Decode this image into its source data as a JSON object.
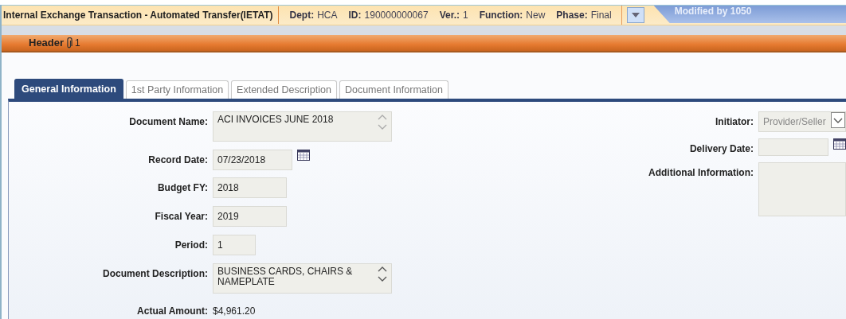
{
  "title_bar": {
    "title": "Internal Exchange Transaction - Automated Transfer(IETAT)",
    "fields": [
      {
        "label": "Dept:",
        "value": "HCA"
      },
      {
        "label": "ID:",
        "value": "190000000067"
      },
      {
        "label": "Ver.:",
        "value": "1"
      },
      {
        "label": "Function:",
        "value": "New"
      },
      {
        "label": "Phase:",
        "value": "Final"
      }
    ],
    "modified": "Modified by 1050"
  },
  "section": {
    "title": "Header",
    "attachment_count": "1"
  },
  "tabs": [
    {
      "label": "General Information",
      "selected": true
    },
    {
      "label": "1st Party Information",
      "selected": false
    },
    {
      "label": "Extended Description",
      "selected": false
    },
    {
      "label": "Document Information",
      "selected": false
    }
  ],
  "left_fields": [
    {
      "label": "Document Name:",
      "value": "ACI INVOICES JUNE 2018",
      "kind": "textarea"
    },
    {
      "label": "Record Date:",
      "value": "07/23/2018",
      "kind": "date"
    },
    {
      "label": "Budget FY:",
      "value": "2018",
      "kind": "text"
    },
    {
      "label": "Fiscal Year:",
      "value": "2019",
      "kind": "text"
    },
    {
      "label": "Period:",
      "value": "1",
      "kind": "short"
    },
    {
      "label": "Document Description:",
      "value": "BUSINESS CARDS, CHAIRS & NAMEPLATE",
      "kind": "textarea"
    },
    {
      "label": "Actual Amount:",
      "value": "$4,961.20",
      "kind": "readout"
    }
  ],
  "right_fields": [
    {
      "label": "Initiator:",
      "value": "Provider/Seller",
      "kind": "select",
      "disabled": true
    },
    {
      "label": "Delivery Date:",
      "kind": "date"
    },
    {
      "label": "Additional Information:",
      "kind": "textarea"
    }
  ]
}
